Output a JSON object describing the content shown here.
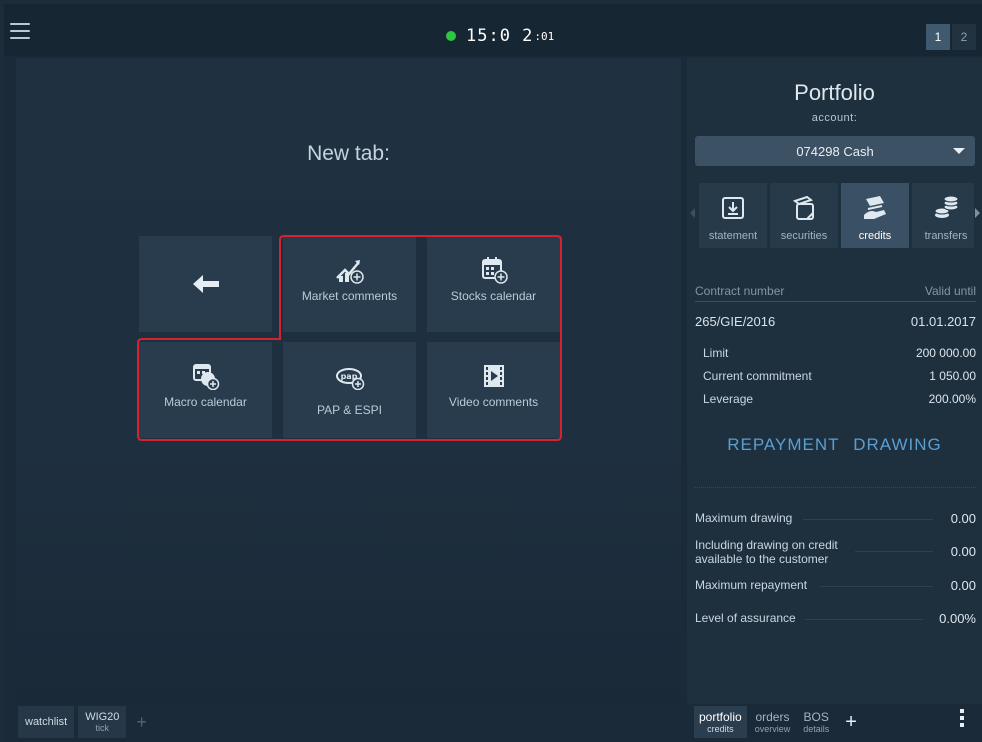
{
  "topbar": {
    "time_main": "15:0 2",
    "time_sec": ":01",
    "status_color": "#2cc640",
    "page_tabs": [
      "1",
      "2"
    ]
  },
  "left": {
    "title": "New tab:",
    "tiles": [
      {
        "label": "",
        "icon": "back-arrow-icon"
      },
      {
        "label": "Market comments",
        "icon": "market-comments-icon"
      },
      {
        "label": "Stocks calendar",
        "icon": "stocks-calendar-icon"
      },
      {
        "label": "Macro calendar",
        "icon": "macro-calendar-icon"
      },
      {
        "label": "PAP & ESPI",
        "icon": "pap-icon"
      },
      {
        "label": "Video comments",
        "icon": "video-icon"
      }
    ],
    "highlight_color": "#d4232e"
  },
  "bottom_left": {
    "tabs": [
      {
        "label": "watchlist",
        "sub": ""
      },
      {
        "label": "WIG20",
        "sub": "tick"
      }
    ],
    "plus": "+"
  },
  "portfolio": {
    "title": "Portfolio",
    "account_label": "account:",
    "account_value": "074298 Cash",
    "functions": [
      {
        "label": "statement",
        "icon": "statement-icon"
      },
      {
        "label": "securities",
        "icon": "securities-icon"
      },
      {
        "label": "credits",
        "icon": "credits-icon",
        "active": true
      },
      {
        "label": "transfers",
        "icon": "transfers-icon"
      }
    ],
    "contract_header": {
      "left": "Contract number",
      "right": "Valid until"
    },
    "contract": {
      "number": "265/GIE/2016",
      "valid_until": "01.01.2017"
    },
    "details": [
      {
        "label": "Limit",
        "value": "200 000.00"
      },
      {
        "label": "Current commitment",
        "value": "1 050.00"
      },
      {
        "label": "Leverage",
        "value": "200.00%"
      }
    ],
    "actions": {
      "repayment": "REPAYMENT",
      "drawing": "DRAWING"
    },
    "summary": [
      {
        "label": "Maximum drawing",
        "value": "0.00"
      },
      {
        "label": "Including drawing on credit available to the customer",
        "value": "0.00"
      },
      {
        "label": "Maximum repayment",
        "value": "0.00"
      },
      {
        "label": "Level of assurance",
        "value": "0.00%"
      }
    ]
  },
  "bottom_right": {
    "tabs": [
      {
        "label": "portfolio",
        "sub": "credits",
        "active": true
      },
      {
        "label": "orders",
        "sub": "overview"
      },
      {
        "label": "BOS",
        "sub": "details"
      }
    ],
    "plus": "+"
  }
}
